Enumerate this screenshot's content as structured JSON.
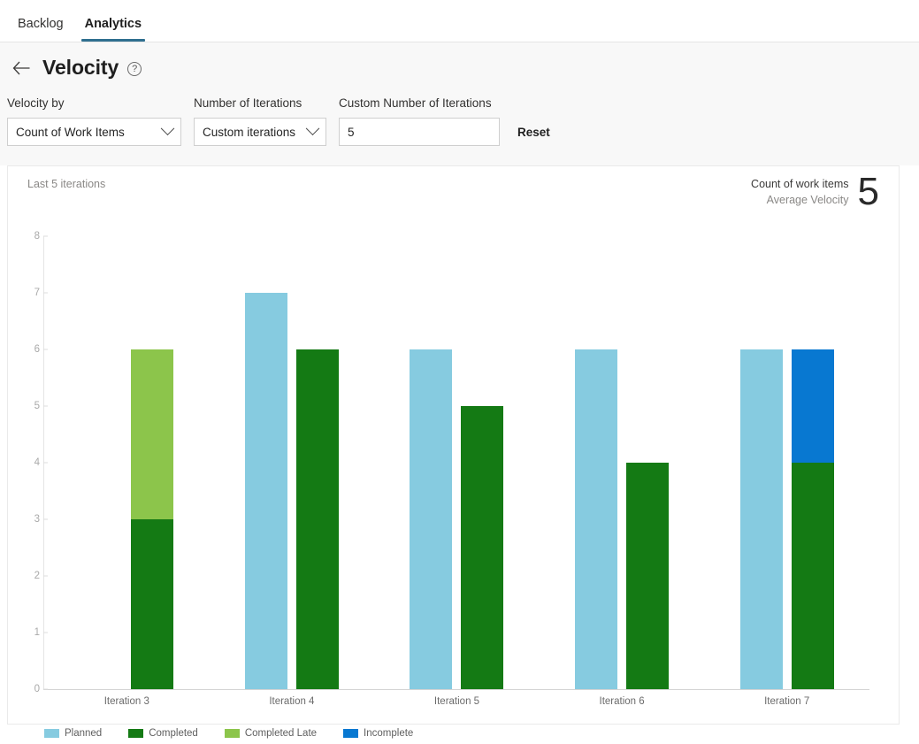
{
  "tabs": [
    {
      "label": "Backlog",
      "active": false
    },
    {
      "label": "Analytics",
      "active": true
    }
  ],
  "header": {
    "back_icon": "arrow-left-icon",
    "title": "Velocity",
    "help_icon": "question-circle-icon"
  },
  "filters": {
    "velocity_by": {
      "label": "Velocity by",
      "value": "Count of Work Items",
      "chevron_icon": "chevron-down-icon"
    },
    "number_of_iterations": {
      "label": "Number of Iterations",
      "value": "Custom iterations",
      "chevron_icon": "chevron-down-icon"
    },
    "custom_number_of_iterations": {
      "label": "Custom Number of Iterations",
      "value": "5",
      "placeholder": "5"
    },
    "reset_label": "Reset"
  },
  "card": {
    "subtitle": "Last 5 iterations",
    "summary_line1": "Count of work items",
    "summary_line2": "Average Velocity",
    "summary_value": "5"
  },
  "colors": {
    "planned": "#86CBE0",
    "completed": "#147A14",
    "completed_late": "#8CC54B",
    "incomplete": "#0878D1",
    "tab_accent": "#2F6F8F",
    "axis": "#D4D4D4",
    "tick_text": "#A9A9A9"
  },
  "chart_data": {
    "type": "bar",
    "title": "Velocity",
    "subtitle": "Last 5 iterations",
    "xlabel": "",
    "ylabel": "Count of work items",
    "ylim": [
      0,
      8
    ],
    "yticks": [
      0,
      1,
      2,
      3,
      4,
      5,
      6,
      7,
      8
    ],
    "grid": false,
    "stacked": true,
    "legend_position": "bottom-left",
    "categories": [
      "Iteration 3",
      "Iteration 4",
      "Iteration 5",
      "Iteration 6",
      "Iteration 7"
    ],
    "series": [
      {
        "name": "Planned",
        "color": "#86CBE0",
        "column": 0,
        "values": [
          0,
          7,
          6,
          6,
          6
        ]
      },
      {
        "name": "Completed",
        "color": "#147A14",
        "column": 1,
        "values": [
          3,
          6,
          5,
          4,
          4
        ]
      },
      {
        "name": "Completed Late",
        "color": "#8CC54B",
        "column": 1,
        "values": [
          3,
          0,
          0,
          0,
          0
        ]
      },
      {
        "name": "Incomplete",
        "color": "#0878D1",
        "column": 1,
        "values": [
          0,
          0,
          0,
          0,
          2
        ]
      }
    ],
    "legend": [
      {
        "label": "Planned",
        "color": "#86CBE0"
      },
      {
        "label": "Completed",
        "color": "#147A14"
      },
      {
        "label": "Completed Late",
        "color": "#8CC54B"
      },
      {
        "label": "Incomplete",
        "color": "#0878D1"
      }
    ],
    "average_velocity": 5
  }
}
